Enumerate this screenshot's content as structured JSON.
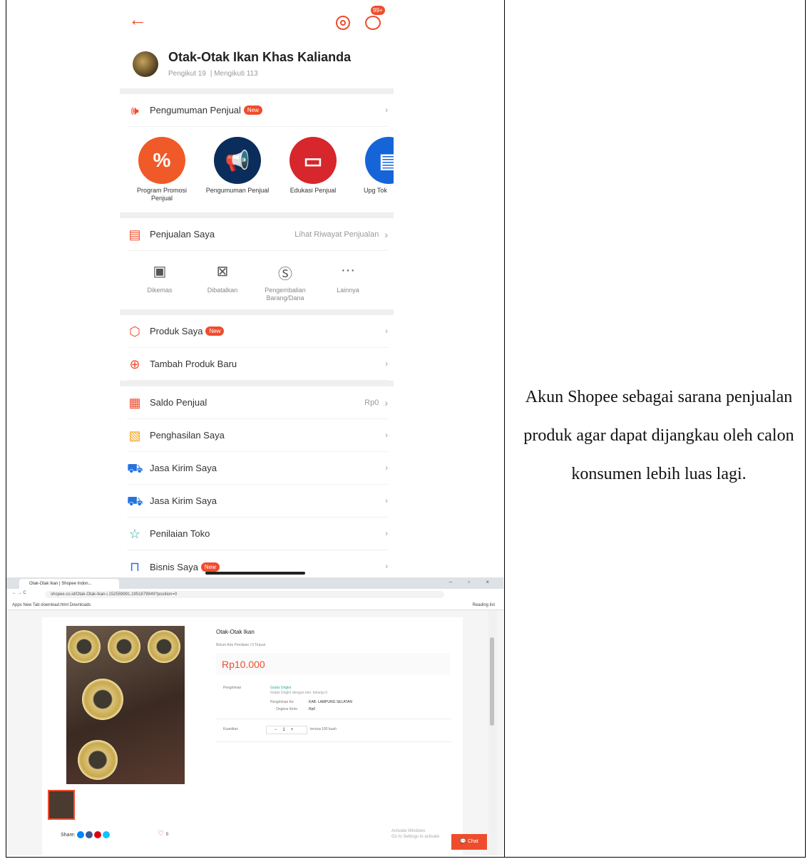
{
  "caption": "Akun Shopee sebagai sarana penjualan produk agar dapat dijangkau oleh calon konsumen lebih luas lagi.",
  "phone": {
    "chat_badge": "99+",
    "shop_name": "Otak-Otak Ikan Khas Kalianda",
    "followers": "Pengikut 19",
    "following": "Mengikuti 113",
    "announce_label": "Pengumuman Penjual",
    "new_badge": "New",
    "tiles": [
      {
        "label": "Program Promosi Penjual",
        "color": "#f05a28",
        "glyph": "%"
      },
      {
        "label": "Pengumuman Penjual",
        "color": "#0b2d5c",
        "glyph": "📢"
      },
      {
        "label": "Edukasi Penjual",
        "color": "#d7262c",
        "glyph": "▭"
      },
      {
        "label": "Upg Tok",
        "color": "#1565d8",
        "glyph": "▤"
      }
    ],
    "sales_label": "Penjualan Saya",
    "sales_link": "Lihat Riwayat Penjualan",
    "sub_items": [
      {
        "label": "Dikemas",
        "glyph": "▣"
      },
      {
        "label": "Dibatalkan",
        "glyph": "⊠"
      },
      {
        "label": "Pengembalian Barang/Dana",
        "glyph": "Ⓢ"
      },
      {
        "label": "Lainnya",
        "glyph": "···"
      }
    ],
    "products_label": "Produk Saya",
    "add_product_label": "Tambah Produk Baru",
    "balance_label": "Saldo Penjual",
    "balance_value": "Rp0",
    "income_label": "Penghasilan Saya",
    "shipping_label_1": "Jasa Kirim Saya",
    "shipping_label_2": "Jasa Kirim Saya",
    "rating_label": "Penilaian Toko",
    "business_label": "Bisnis Saya"
  },
  "desktop": {
    "tab_title": "Otak-Otak Ikan | Shopee Indon...",
    "url": "shopee.co.id/Otak-Otak-Ikan-i.152559991.1951879949?position=0",
    "bookmarks": "Apps   New Tab   download.html   Downloads",
    "reading_list": "Reading list",
    "product_title": "Otak-Otak Ikan",
    "product_meta": "Belum Ada Penilaian  |  0 Terjual",
    "price": "Rp10.000",
    "shipping_label": "Pengiriman",
    "free_shipping": "Gratis Ongkir",
    "free_shipping_note": "Gratis Ongkir dengan min. belanja 0",
    "ship_to_label": "Pengiriman Ke",
    "ship_to_value": "KAB. LAMPUNG SELATAN",
    "ship_cost_label": "Ongkos Kirim",
    "ship_cost_value": "Rp0",
    "quantity_label": "Kuantitas",
    "quantity_value": "1",
    "stock": "tersisa 100 buah",
    "share_label": "Share:",
    "like_count": "0",
    "activate_title": "Activate Windows",
    "activate_text": "Go to Settings to activate",
    "chat_label": "Chat"
  }
}
